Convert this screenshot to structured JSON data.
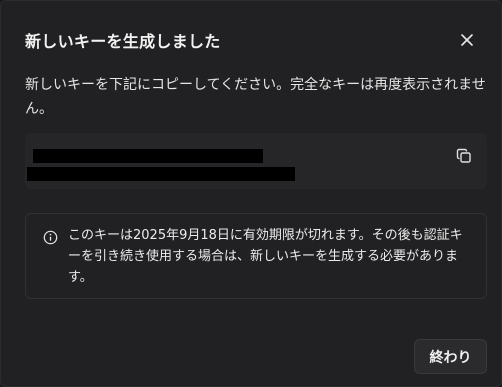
{
  "dialog": {
    "title": "新しいキーを生成しました",
    "description": "新しいキーを下記にコピーしてください。完全なキーは再度表示されません。",
    "notice": "このキーは2025年9月18日に有効期限が切れます。その後も認証キーを引き続き使用する場合は、新しいキーを生成する必要があります。",
    "done_label": "終わり"
  },
  "key": {
    "partial_visible": "...........  ...  ..  ...  ......"
  },
  "icons": {
    "close": "close-icon",
    "copy": "copy-icon",
    "info": "info-icon"
  },
  "colors": {
    "background": "#212123",
    "key_box": "#262629",
    "button": "#2b2b2e",
    "text": "#ececf1"
  }
}
